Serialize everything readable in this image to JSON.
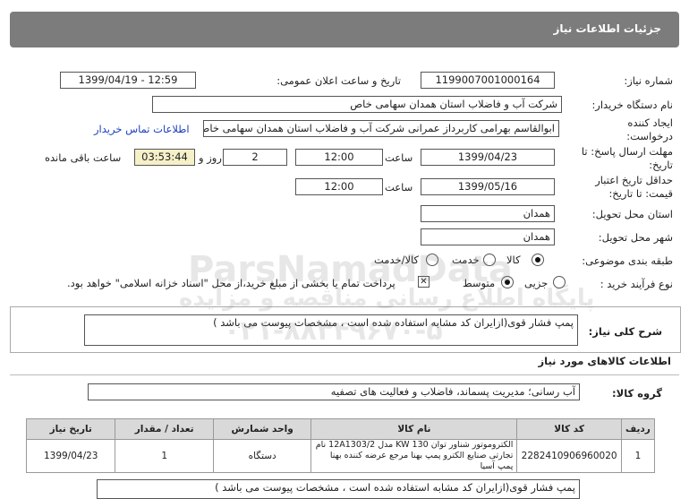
{
  "header": {
    "title": "جزئیات اطلاعات نیاز"
  },
  "fields": {
    "need_number_label": "شماره نیاز:",
    "need_number": "1199007001000164",
    "announce_label": "تاریخ و ساعت اعلان عمومی:",
    "announce_value": "1399/04/19 - 12:59",
    "buyer_label": "نام دستگاه خریدار:",
    "buyer_value": "شرکت آب و فاضلاب استان همدان سهامی خاص",
    "creator_label": "ایجاد کننده درخواست:",
    "creator_value": "ابوالقاسم بهرامی کاربرداز عمرانی شرکت آب و فاضلاب استان همدان سهامی خاص",
    "contact_link": "اطلاعات تماس خریدار",
    "send_deadline_label": "مهلت ارسال پاسخ: تا تاریخ:",
    "send_date": "1399/04/23",
    "time_label": "ساعت",
    "send_time": "12:00",
    "days_value": "2",
    "days_label": "روز و",
    "remaining_time": "03:53:44",
    "remaining_label": "ساعت باقی مانده",
    "validity_label": "حداقل تاریخ اعتبار قیمت: تا تاریخ:",
    "validity_date": "1399/05/16",
    "validity_time": "12:00",
    "province_label": "استان محل تحویل:",
    "province_value": "همدان",
    "city_label": "شهر محل تحویل:",
    "city_value": "همدان",
    "category_label": "طبقه بندی موضوعی:",
    "cat_goods": "کالا",
    "cat_service": "خدمت",
    "cat_both": "کالا/خدمت",
    "process_label": "نوع فرآیند خرید :",
    "proc_partial": "جزیی",
    "proc_medium": "متوسط",
    "payment_note": "پرداخت تمام یا بخشی از مبلغ خرید،از محل \"اسناد خزانه اسلامی\" خواهد بود."
  },
  "description": {
    "label": "شرح کلی نیاز:",
    "text": "پمپ فشار قوی(ازایران کد مشابه استفاده شده است ، مشخصات پیوست می باشد )"
  },
  "goods_section": {
    "title": "اطلاعات کالاهای مورد نیاز",
    "group_label": "گروه کالا:",
    "group_value": "آب رسانی؛ مدیریت پسماند، فاضلاب و فعالیت های تصفیه"
  },
  "table": {
    "headers": [
      "ردیف",
      "کد کالا",
      "نام کالا",
      "واحد شمارش",
      "تعداد / مقدار",
      "تاریخ نیاز"
    ],
    "rows": [
      {
        "row": "1",
        "code": "2282410906960020",
        "name": "الکتروموتور شناور توان 130 KW مدل 12A1303/2 نام تجارتی صنایع الکترو پمپ بهنا مرجع عرضه کننده بهنا پمپ آسیا",
        "unit": "دستگاه",
        "qty": "1",
        "date": "1399/04/23"
      }
    ]
  },
  "bottom_cutoff_text": "پمپ فشار قوی(ازایران کد مشابه استفاده شده است ، مشخصات پیوست می باشد )",
  "watermark": {
    "line1": "ParsNamadData",
    "line2": "پایگاه اطلاع رسانی مناقصه و مزایده",
    "line3": "۰۲۱-۸۸۳۴۹۶۷۰-۵"
  },
  "colors": {
    "header_bg": "#7c7c7c",
    "remaining_bg": "#f5f0c8",
    "link": "#1a3fbf",
    "table_header": "#d9d9d9"
  }
}
